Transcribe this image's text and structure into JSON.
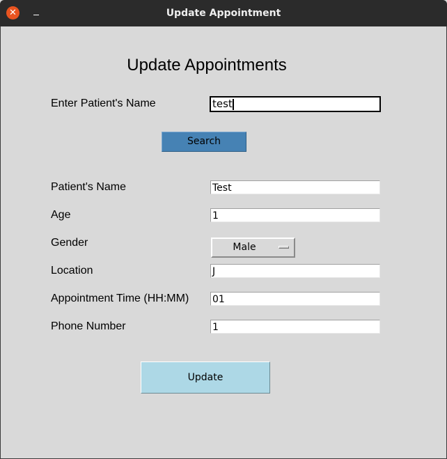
{
  "window": {
    "title": "Update Appointment"
  },
  "heading": "Update Appointments",
  "search": {
    "label": "Enter Patient's Name",
    "value": "test",
    "button": "Search"
  },
  "form": {
    "name": {
      "label": "Patient's Name",
      "value": "Test"
    },
    "age": {
      "label": "Age",
      "value": "1"
    },
    "gender": {
      "label": "Gender",
      "value": "Male"
    },
    "location": {
      "label": "Location",
      "value": "J"
    },
    "time": {
      "label": "Appointment Time (HH:MM)",
      "value": "01"
    },
    "phone": {
      "label": "Phone Number",
      "value": "1"
    }
  },
  "update_button": "Update",
  "colors": {
    "search_button": "#4682b4",
    "update_button": "#add8e6",
    "background": "#d9d9d9",
    "close": "#e95420"
  }
}
